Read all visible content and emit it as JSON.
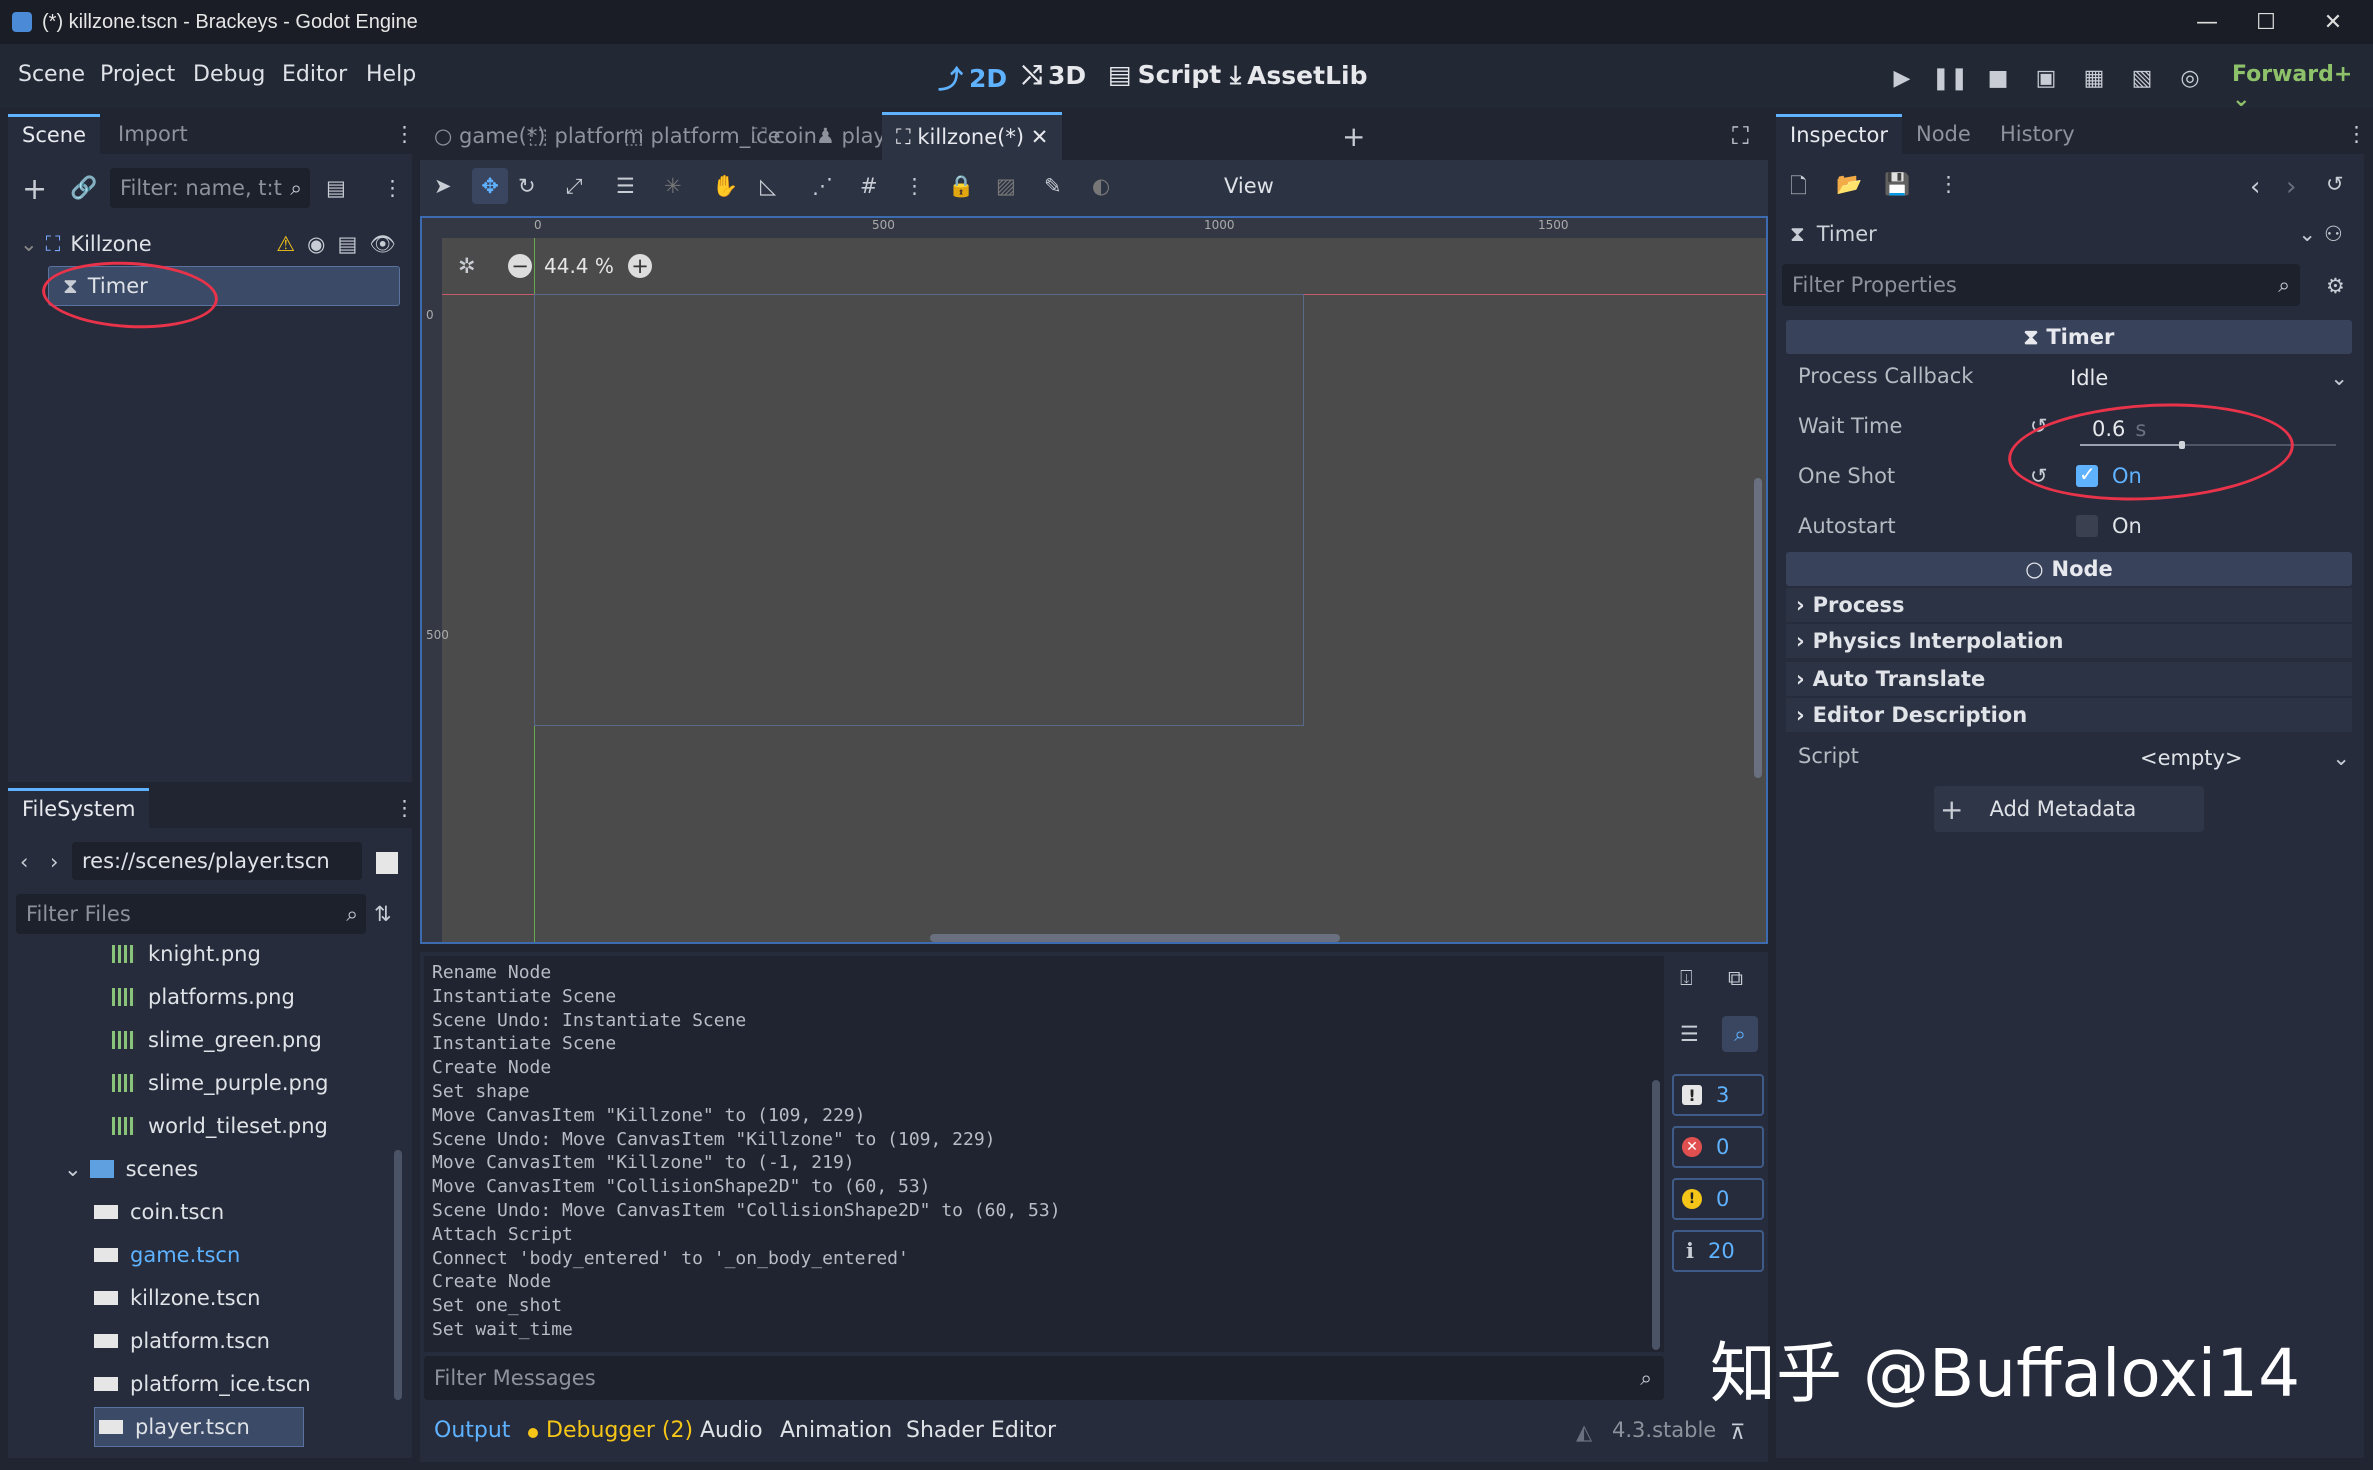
{
  "window": {
    "title": "(*) killzone.tscn - Brackeys - Godot Engine",
    "minimize": "—",
    "maximize": "☐",
    "close": "✕"
  },
  "menu": {
    "items": [
      "Scene",
      "Project",
      "Debug",
      "Editor",
      "Help"
    ],
    "modes": [
      "2D",
      "3D",
      "Script",
      "AssetLib"
    ],
    "active_mode": "2D",
    "renderer": "Forward+"
  },
  "scene_dock": {
    "tabs": [
      "Scene",
      "Import"
    ],
    "filter_placeholder": "Filter: name, t:t",
    "root": "Killzone",
    "child": "Timer"
  },
  "filesystem": {
    "tab": "FileSystem",
    "path": "res://scenes/player.tscn",
    "filter_placeholder": "Filter Files",
    "items": [
      {
        "name": "knight.png",
        "type": "image"
      },
      {
        "name": "platforms.png",
        "type": "image"
      },
      {
        "name": "slime_green.png",
        "type": "image"
      },
      {
        "name": "slime_purple.png",
        "type": "image"
      },
      {
        "name": "world_tileset.png",
        "type": "image"
      },
      {
        "name": "scenes",
        "type": "folder"
      },
      {
        "name": "coin.tscn",
        "type": "scene"
      },
      {
        "name": "game.tscn",
        "type": "scene"
      },
      {
        "name": "killzone.tscn",
        "type": "scene"
      },
      {
        "name": "platform.tscn",
        "type": "scene"
      },
      {
        "name": "platform_ice.tscn",
        "type": "scene"
      },
      {
        "name": "player.tscn",
        "type": "scene"
      }
    ]
  },
  "editor_tabs": [
    {
      "label": "game(*)"
    },
    {
      "label": "platform"
    },
    {
      "label": "platform_ice"
    },
    {
      "label": "coin"
    },
    {
      "label": "player"
    },
    {
      "label": "killzone(*)",
      "active": true
    }
  ],
  "toolbar": {
    "view_label": "View",
    "zoom": "44.4 %"
  },
  "ruler": {
    "x_ticks": [
      "0",
      "500",
      "1000",
      "1500"
    ],
    "y_ticks": [
      "0",
      "500"
    ]
  },
  "output": {
    "lines": [
      "Rename Node",
      "Instantiate Scene",
      "Scene Undo: Instantiate Scene",
      "Instantiate Scene",
      "Create Node",
      "Set shape",
      "Move CanvasItem \"Killzone\" to (109, 229)",
      "Scene Undo: Move CanvasItem \"Killzone\" to (109, 229)",
      "Move CanvasItem \"Killzone\" to (-1, 219)",
      "Move CanvasItem \"CollisionShape2D\" to (60, 53)",
      "Scene Undo: Move CanvasItem \"CollisionShape2D\" to (60, 53)",
      "Attach Script",
      "Connect 'body_entered' to '_on_body_entered'",
      "Create Node",
      "Set one_shot",
      "Set wait_time"
    ],
    "filter_placeholder": "Filter Messages",
    "counts": {
      "messages": "3",
      "errors": "0",
      "warnings": "0",
      "editor": "20"
    }
  },
  "bottom_panel": {
    "tabs": [
      "Output",
      "Debugger (2)",
      "Audio",
      "Animation",
      "Shader Editor"
    ],
    "version": "4.3.stable"
  },
  "inspector": {
    "tabs": [
      "Inspector",
      "Node",
      "History"
    ],
    "object": "Timer",
    "filter_placeholder": "Filter Properties",
    "section_timer": "Timer",
    "process_callback_label": "Process Callback",
    "process_callback_value": "Idle",
    "wait_time_label": "Wait Time",
    "wait_time_value": "0.6",
    "wait_time_unit": "s",
    "wait_time_slider_fraction": 0.4,
    "one_shot_label": "One Shot",
    "one_shot_value": "On",
    "one_shot_checked": true,
    "autostart_label": "Autostart",
    "autostart_value": "On",
    "autostart_checked": false,
    "section_node": "Node",
    "groups": [
      "Process",
      "Physics Interpolation",
      "Auto Translate",
      "Editor Description"
    ],
    "script_label": "Script",
    "script_value": "<empty>",
    "add_metadata": "Add Metadata"
  },
  "watermark": "知乎 @Buffaloxi14",
  "colors": {
    "accent": "#5fb2ff",
    "renderer": "#8ec26a",
    "annotation": "#e8334a",
    "warning": "#f5c518",
    "error": "#e05050"
  }
}
